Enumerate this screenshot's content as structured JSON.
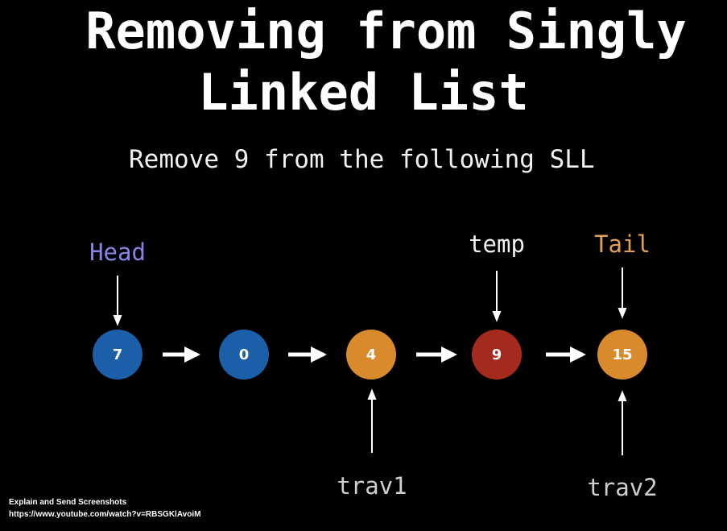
{
  "title_line1": "Removing from Singly",
  "title_line2": "Linked List",
  "subtitle": "Remove 9 from the following SLL",
  "nodes": [
    {
      "value": "7",
      "color": "#1a5fa8"
    },
    {
      "value": "0",
      "color": "#1a5fa8"
    },
    {
      "value": "4",
      "color": "#d98a2c"
    },
    {
      "value": "9",
      "color": "#a52a1e"
    },
    {
      "value": "15",
      "color": "#d98a2c"
    }
  ],
  "pointers": {
    "head": {
      "label": "Head",
      "color": "#8b84e8"
    },
    "temp": {
      "label": "temp",
      "color": "#f2f2f2"
    },
    "tail": {
      "label": "Tail",
      "color": "#e0a050"
    },
    "trav1": {
      "label": "trav1",
      "color": "#cfcfcf"
    },
    "trav2": {
      "label": "trav2",
      "color": "#cfcfcf"
    }
  },
  "footer": {
    "line1": "Explain and Send Screenshots",
    "line2": "https://www.youtube.com/watch?v=RBSGKlAvoiM"
  }
}
